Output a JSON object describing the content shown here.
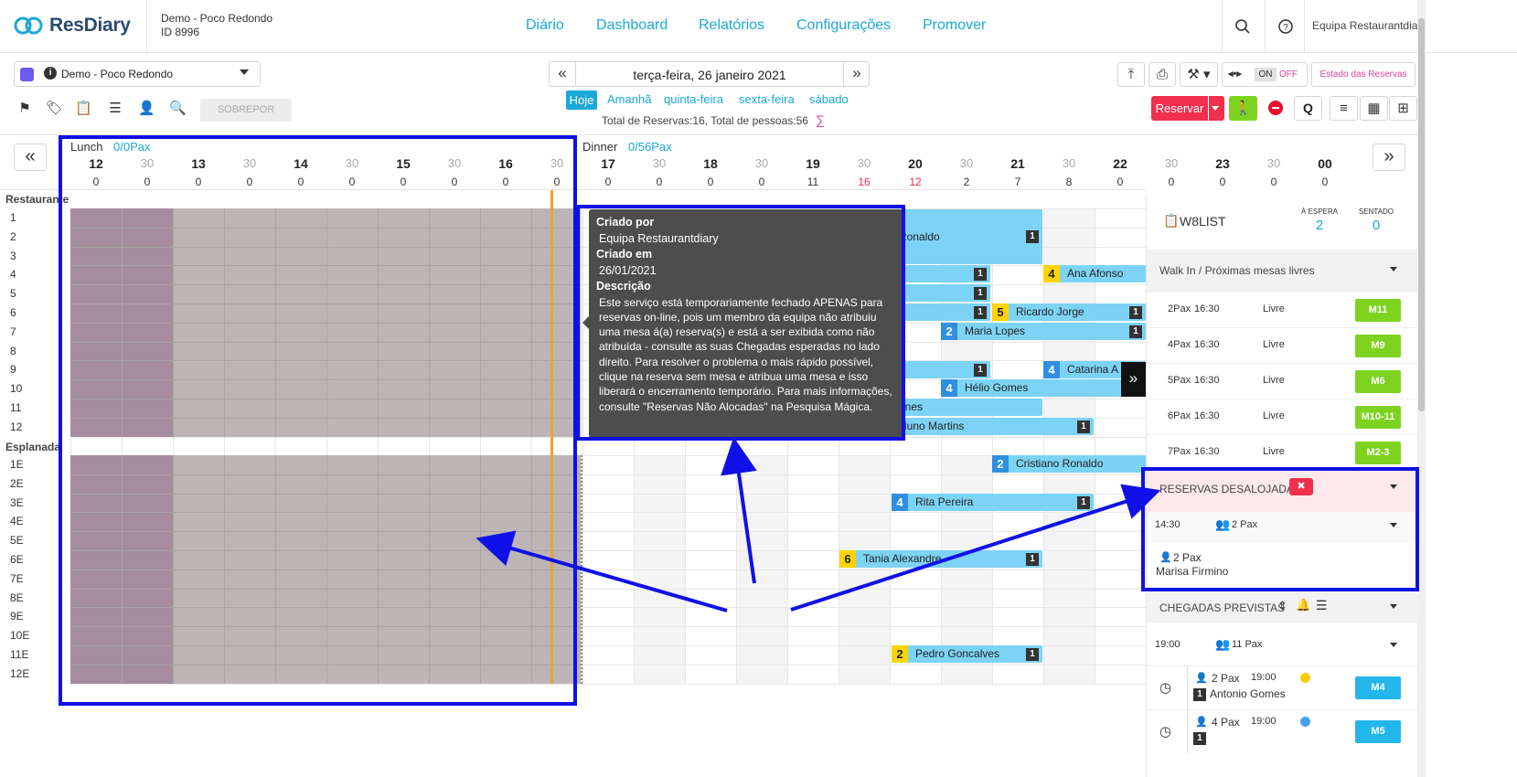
{
  "header": {
    "logo": "ResDiary",
    "restaurant_name": "Demo - Poco Redondo",
    "restaurant_id": "ID 8996",
    "nav": [
      "Diário",
      "Dashboard",
      "Relatórios",
      "Configurações",
      "Promover"
    ],
    "user": "Equipa Restaurantdiary"
  },
  "toolbar": {
    "restaurant_select": "Demo - Poco Redondo",
    "date": "terça-feira, 26 janeiro 2021",
    "days": [
      "Hoje",
      "Amanhã",
      "quinta-feira",
      "sexta-feira",
      "sábado"
    ],
    "totals_prefix": "Total de Reservas:",
    "total_reservations": "16",
    "totals_mid": ", Total de pessoas:",
    "total_people": "56",
    "overlay_button": "SOBREPOR",
    "on": "ON",
    "off": "OFF",
    "reservation_state": "Estado das Reservas",
    "reserve_button": "Reservar",
    "q_button": "Q",
    "colors": {
      "accent": "#1aa8d8",
      "reserve": "#f0304d",
      "walkin": "#7ed321"
    }
  },
  "timeline": {
    "lunch_label": "Lunch",
    "lunch_pax": "0/0Pax",
    "dinner_label": "Dinner",
    "dinner_pax": "0/56Pax",
    "ticks": [
      "12",
      "30",
      "13",
      "30",
      "14",
      "30",
      "15",
      "30",
      "16",
      "30",
      "17",
      "30",
      "18",
      "30",
      "19",
      "30",
      "20",
      "30",
      "21",
      "30",
      "22",
      "30",
      "23",
      "30",
      "00"
    ],
    "counts": [
      "0",
      "0",
      "0",
      "0",
      "0",
      "0",
      "0",
      "0",
      "0",
      "0",
      "0",
      "0",
      "0",
      "0",
      "11",
      "16",
      "12",
      "2",
      "7",
      "8",
      "0",
      "0",
      "0",
      "0",
      "0"
    ]
  },
  "sections": [
    {
      "name": "Restaurante",
      "rows": [
        "1",
        "2",
        "3",
        "4",
        "5",
        "6",
        "7",
        "8",
        "9",
        "10",
        "11",
        "12"
      ]
    },
    {
      "name": "Esplanada",
      "rows": [
        "1E",
        "2E",
        "3E",
        "4E",
        "5E",
        "6E",
        "7E",
        "8E",
        "9E",
        "10E",
        "11E",
        "12E"
      ]
    }
  ],
  "bookings": [
    {
      "pax": "",
      "name": "Ronaldo",
      "tag": "1"
    },
    {
      "pax": "4",
      "name": "Ana Afonso",
      "tag": ""
    },
    {
      "pax": "",
      "name": "",
      "tag": "1"
    },
    {
      "pax": "",
      "name": "",
      "tag": "1"
    },
    {
      "pax": "",
      "name": "",
      "tag": "1"
    },
    {
      "pax": "5",
      "name": "Ricardo Jorge",
      "tag": "1"
    },
    {
      "pax": "2",
      "name": "Maria Lopes",
      "tag": "1"
    },
    {
      "pax": "",
      "name": "",
      "tag": "1"
    },
    {
      "pax": "4",
      "name": "Catarina A",
      "tag": ""
    },
    {
      "pax": "4",
      "name": "Hélio Gomes",
      "tag": "1"
    },
    {
      "pax": "",
      "name": "unes",
      "tag": ""
    },
    {
      "pax": "",
      "name": "Nuno Martins",
      "tag": "1"
    },
    {
      "pax": "2",
      "name": "Cristiano Ronaldo",
      "tag": ""
    },
    {
      "pax": "4",
      "name": "Rita Pereira",
      "tag": "1"
    },
    {
      "pax": "6",
      "name": "Tania Alexandre",
      "tag": "1"
    },
    {
      "pax": "2",
      "name": "Pedro Goncalves",
      "tag": "1"
    }
  ],
  "tooltip": {
    "created_by_label": "Criado por",
    "created_by": "Equipa Restaurantdiary",
    "created_at_label": "Criado em",
    "created_at": "26/01/2021",
    "description_label": "Descrição",
    "description": "Este serviço está temporariamente fechado APENAS para reservas on-line, pois um membro da equipa não atribuiu uma mesa á(a) reserva(s) e está a ser exibida como não atribuída - consulte as suas Chegadas esperadas no lado direito. Para resolver o problema o mais rápido possível, clique na reserva sem mesa e atribua uma mesa e isso liberará o encerramento temporário. Para mais informações, consulte \"Reservas Não Alocadas\" na Pesquisa Mágica."
  },
  "sidepanel": {
    "w8list": "W8LIST",
    "waiting_label": "À ESPERA",
    "waiting_count": "2",
    "seated_label": "SENTADO",
    "seated_count": "0",
    "walkin_title": "Walk In / Próximas mesas livres",
    "walkin_rows": [
      {
        "pax": "2Pax",
        "time": "16:30",
        "status": "Livre",
        "table": "M11"
      },
      {
        "pax": "4Pax",
        "time": "16:30",
        "status": "Livre",
        "table": "M9"
      },
      {
        "pax": "5Pax",
        "time": "16:30",
        "status": "Livre",
        "table": "M6"
      },
      {
        "pax": "6Pax",
        "time": "16:30",
        "status": "Livre",
        "table": "M10-11"
      },
      {
        "pax": "7Pax",
        "time": "16:30",
        "status": "Livre",
        "table": "M2-3"
      }
    ],
    "displaced_title": "RESERVAS DESALOJADAS",
    "displaced_time": "14:30",
    "displaced_pax": "2 Pax",
    "displaced_item_pax": "2 Pax",
    "displaced_item_name": "Marisa Firmino",
    "arrivals_title": "CHEGADAS PREVISTAS",
    "arrivals_time": "19:00",
    "arrivals_pax": "11 Pax",
    "arrivals": [
      {
        "pax": "2 Pax",
        "time": "19:00",
        "name": "Antonio Gomes",
        "table": "M4",
        "tag": "1"
      },
      {
        "pax": "4 Pax",
        "time": "19:00",
        "name": "",
        "table": "M5",
        "tag": "1"
      }
    ]
  }
}
